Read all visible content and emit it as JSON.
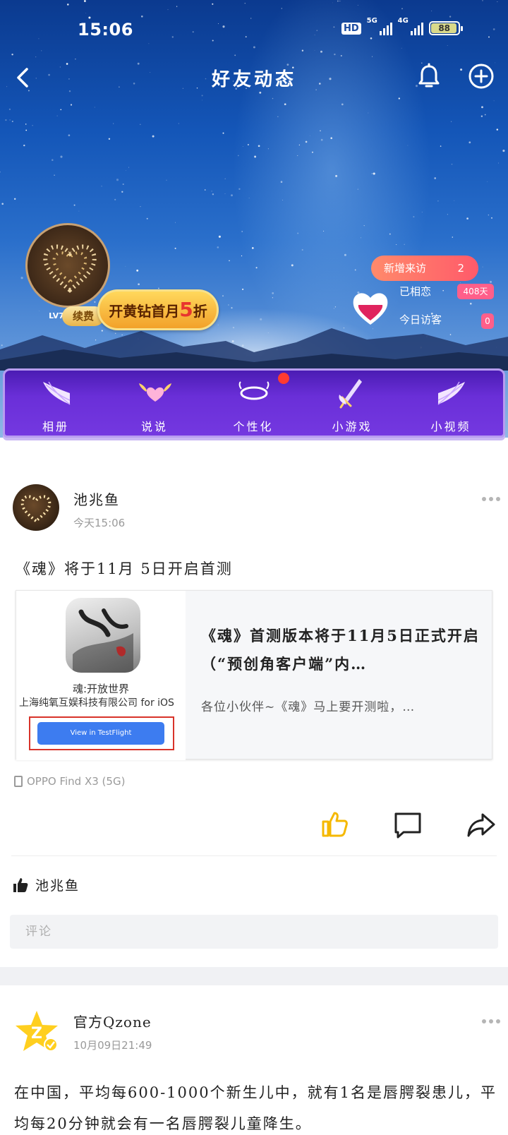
{
  "status_bar": {
    "time": "15:06",
    "hd": "HD",
    "net1": "5G",
    "net2": "4G",
    "battery": "88"
  },
  "nav": {
    "title": "好友动态"
  },
  "profile": {
    "level": "LV7",
    "renew_label": "续费",
    "vip_promo_prefix": "开黄钻首月",
    "vip_promo_number": "5",
    "vip_promo_suffix": "折",
    "new_visits_label": "新增来访",
    "new_visits_count": "2",
    "days_label": "已相恋",
    "days_value": "408天",
    "today_visitors_label": "今日访客",
    "today_visitors_value": "0"
  },
  "menu": [
    {
      "label": "相册",
      "icon": "wing-icon"
    },
    {
      "label": "说说",
      "icon": "heart-wing-icon"
    },
    {
      "label": "个性化",
      "icon": "halo-icon"
    },
    {
      "label": "小游戏",
      "icon": "sword-icon"
    },
    {
      "label": "小视频",
      "icon": "wing-icon"
    }
  ],
  "post1": {
    "author": "池兆鱼",
    "time": "今天15:06",
    "text": "《魂》将于11月 5日开启首测",
    "card": {
      "app_name": "魂:开放世界",
      "company": "上海纯氧互娱科技有限公司 for iOS",
      "button": "View in TestFlight",
      "title": "《魂》首测版本将于11月5日正式开启（“预创角客户端”内…",
      "desc": "各位小伙伴~《魂》马上要开测啦，…"
    },
    "device": "OPPO Find X3 (5G)",
    "liked_by": "池兆鱼",
    "comment_placeholder": "评论"
  },
  "post2": {
    "author": "官方Qzone",
    "time": "10月09日21:49",
    "text": "在中国，平均每600-1000个新生儿中，就有1名是唇腭裂患儿，平均每20分钟就会有一名唇腭裂儿童降生。"
  },
  "colors": {
    "menu_purple": "#6a2fd8",
    "like_yellow": "#f5b800",
    "badge_pink": "#ff5f8a",
    "testflight_blue": "#3d7cf0"
  }
}
